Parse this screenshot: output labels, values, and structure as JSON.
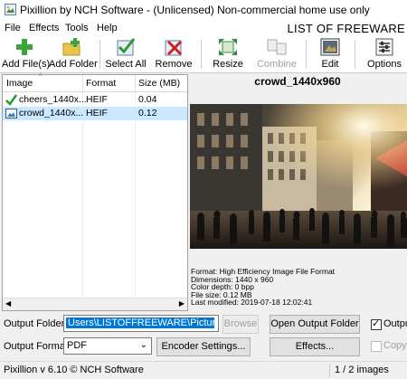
{
  "window": {
    "title": "Pixillion by NCH Software - (Unlicensed) Non-commercial home use only",
    "watermark": "LIST OF FREEWARE"
  },
  "menu": {
    "items": [
      "File",
      "Effects",
      "Tools",
      "Help"
    ]
  },
  "toolbar": {
    "add_files": "Add File(s)",
    "add_folder": "Add Folder",
    "select_all": "Select All",
    "remove": "Remove",
    "resize": "Resize",
    "combine": "Combine",
    "edit": "Edit",
    "options": "Options"
  },
  "file_list": {
    "columns": [
      "Image",
      "Format",
      "Size (MB)"
    ],
    "rows": [
      {
        "name": "cheers_1440x...",
        "format": "HEIF",
        "size": "0.04",
        "selected": false,
        "icon": "check-icon"
      },
      {
        "name": "crowd_1440x...",
        "format": "HEIF",
        "size": "0.12",
        "selected": true,
        "icon": "image-file-icon"
      }
    ]
  },
  "preview": {
    "title": "crowd_1440x960",
    "info": [
      "Format: High Efficiency Image File Format",
      "Dimensions: 1440 x 960",
      "Color depth: 0 bpp",
      "File size: 0.12 MB",
      "Last modified: 2019-07-18 12:02:41"
    ]
  },
  "output": {
    "folder_label": "Output Folder:",
    "folder_value": "Users\\LISTOFFREEWARE\\Pictures",
    "browse": "Browse",
    "open_output_folder": "Open Output Folder",
    "checkbox_output": "Outpu",
    "format_label": "Output Format:",
    "format_value": "PDF",
    "encoder_settings": "Encoder Settings...",
    "effects": "Effects...",
    "checkbox_copy": "Copy f"
  },
  "status": {
    "left": "Pixillion v 6.10 © NCH Software",
    "right": "1 / 2 images"
  }
}
